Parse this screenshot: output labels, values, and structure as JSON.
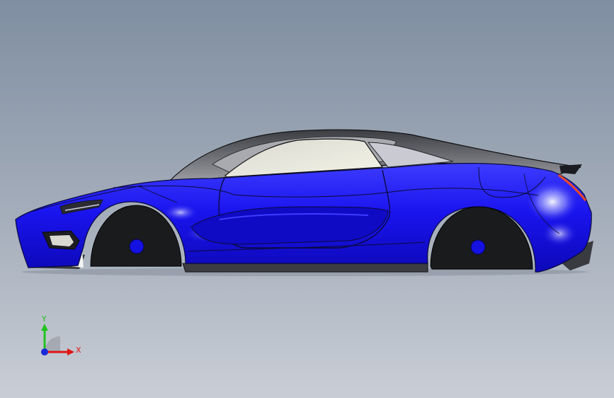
{
  "viewport": {
    "model": "sports-car-body",
    "colors": {
      "body": "#1a14ee",
      "body_highlight": "#6f79ff",
      "body_shadow": "#0b06a8",
      "edge": "#0a0a3a",
      "glass": "#efeede",
      "roof": "#8a8d95",
      "wheel": "#1a1b1d",
      "hub": "#1511e0",
      "taillight": "#e8452a"
    }
  },
  "triad": {
    "x_label": "X",
    "y_label": "Y",
    "colors": {
      "x": "#e01515",
      "y": "#22c21e",
      "z": "#1a2ad8"
    }
  }
}
